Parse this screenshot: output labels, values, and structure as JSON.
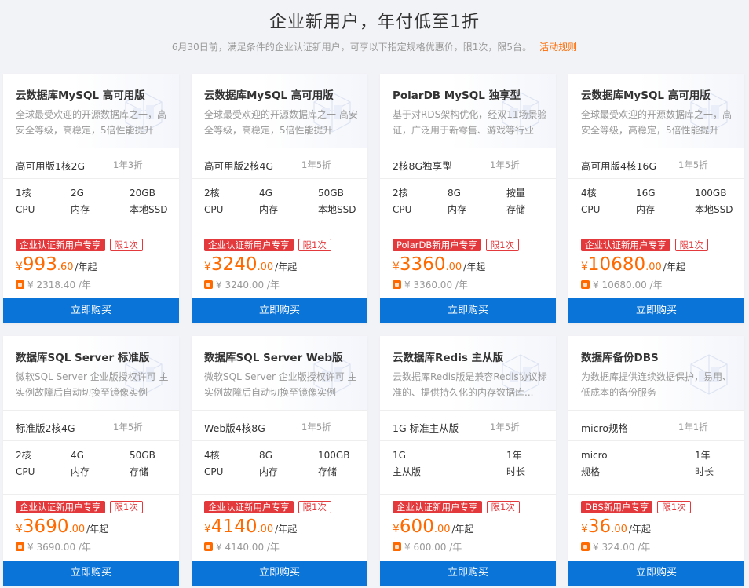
{
  "header": {
    "title": "企业新用户，年付低至1折",
    "subtitle": "6月30日前，满足条件的企业认证新用户，可享以下指定规格优惠价，限1次，限5台。",
    "rule_link": "活动规则"
  },
  "buy_label": "立即购买",
  "colors": {
    "accent": "#ff6a00",
    "promo": "#e4393c",
    "button": "#0a74d9"
  },
  "cards": [
    {
      "title": "云数据库MySQL 高可用版",
      "desc": "全球最受欢迎的开源数据库之一，高安全等级，高稳定，5倍性能提升",
      "spec": "高可用版1核2G",
      "discount": "1年3折",
      "params": [
        [
          "1核",
          "CPU"
        ],
        [
          "2G",
          "内存"
        ],
        [
          "20GB",
          "本地SSD"
        ]
      ],
      "promo": "企业认证新用户专享",
      "limit": "限1次",
      "yen": "¥",
      "price_int": "993",
      "price_dec": ".60",
      "unit": "/年起",
      "original": "¥ 2318.40 /年"
    },
    {
      "title": "云数据库MySQL 高可用版",
      "desc": "全球最受欢迎的开源数据库之一 高安全等级，高稳定，5倍性能提升",
      "spec": "高可用版2核4G",
      "discount": "1年5折",
      "params": [
        [
          "2核",
          "CPU"
        ],
        [
          "4G",
          "内存"
        ],
        [
          "50GB",
          "本地SSD"
        ]
      ],
      "promo": "企业认证新用户专享",
      "limit": "限1次",
      "yen": "¥",
      "price_int": "3240",
      "price_dec": ".00",
      "unit": "/年起",
      "original": "¥ 3240.00 /年"
    },
    {
      "title": "PolarDB MySQL 独享型",
      "desc": "基于对RDS架构优化，经双11场景验证，广泛用于新零售、游戏等行业",
      "spec": "2核8G独享型",
      "discount": "1年5折",
      "params": [
        [
          "2核",
          "CPU"
        ],
        [
          "8G",
          "内存"
        ],
        [
          "按量",
          "存储"
        ]
      ],
      "promo": "PolarDB新用户专享",
      "limit": "限1次",
      "yen": "¥",
      "price_int": "3360",
      "price_dec": ".00",
      "unit": "/年起",
      "original": "¥ 3360.00 /年"
    },
    {
      "title": "云数据库MySQL 高可用版",
      "desc": "全球最受欢迎的开源数据库之一，高安全等级，高稳定，5倍性能提升",
      "spec": "高可用版4核16G",
      "discount": "1年5折",
      "params": [
        [
          "4核",
          "CPU"
        ],
        [
          "16G",
          "内存"
        ],
        [
          "100GB",
          "本地SSD"
        ]
      ],
      "promo": "企业认证新用户专享",
      "limit": "限1次",
      "yen": "¥",
      "price_int": "10680",
      "price_dec": ".00",
      "unit": "/年起",
      "original": "¥ 10680.00 /年"
    },
    {
      "title": "数据库SQL Server 标准版",
      "desc": "微软SQL Server 企业版授权许可 主实例故障后自动切换至镜像实例",
      "spec": "标准版2核4G",
      "discount": "1年5折",
      "params": [
        [
          "2核",
          "CPU"
        ],
        [
          "4G",
          "内存"
        ],
        [
          "50GB",
          "存储"
        ]
      ],
      "promo": "企业认证新用户专享",
      "limit": "限1次",
      "yen": "¥",
      "price_int": "3690",
      "price_dec": ".00",
      "unit": "/年起",
      "original": "¥ 3690.00 /年"
    },
    {
      "title": "数据库SQL Server Web版",
      "desc": "微软SQL Server 企业版授权许可 主实例故障后自动切换至镜像实例",
      "spec": "Web版4核8G",
      "discount": "1年5折",
      "params": [
        [
          "4核",
          "CPU"
        ],
        [
          "8G",
          "内存"
        ],
        [
          "100GB",
          "存储"
        ]
      ],
      "promo": "企业认证新用户专享",
      "limit": "限1次",
      "yen": "¥",
      "price_int": "4140",
      "price_dec": ".00",
      "unit": "/年起",
      "original": "¥ 4140.00 /年"
    },
    {
      "title": "云数据库Redis 主从版",
      "desc": "云数据库Redis版是兼容Redis协议标准的、提供持久化的内存数据库...",
      "spec": "1G 标准主从版",
      "discount": "1年5折",
      "params": [
        [
          "1G",
          "主从版"
        ],
        [
          "",
          ""
        ],
        [
          "1年",
          "时长"
        ]
      ],
      "promo": "企业认证新用户专享",
      "limit": "限1次",
      "yen": "¥",
      "price_int": "600",
      "price_dec": ".00",
      "unit": "/年起",
      "original": "¥ 600.00 /年"
    },
    {
      "title": "数据库备份DBS",
      "desc": "为数据库提供连续数据保护，易用、低成本的备份服务",
      "spec": "micro规格",
      "discount": "1年1折",
      "params": [
        [
          "micro",
          "规格"
        ],
        [
          "",
          ""
        ],
        [
          "1年",
          "时长"
        ]
      ],
      "promo": "DBS新用户专享",
      "limit": "限1次",
      "yen": "¥",
      "price_int": "36",
      "price_dec": ".00",
      "unit": "/年起",
      "original": "¥ 324.00 /年"
    }
  ]
}
